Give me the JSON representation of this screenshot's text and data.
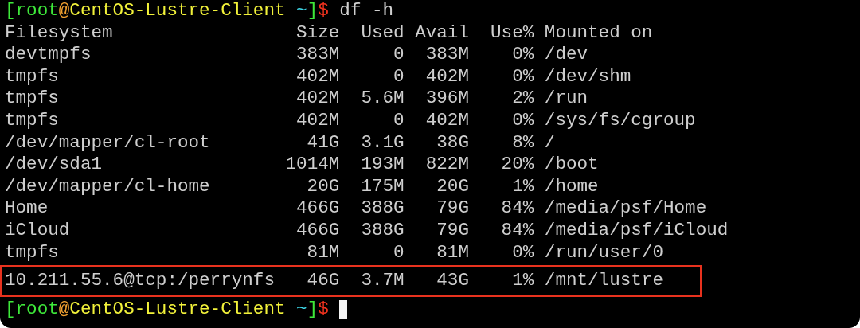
{
  "lines": [
    {
      "kind": "prompt",
      "segments": [
        {
          "text": "[root",
          "color": "#3ee83a"
        },
        {
          "text": "@",
          "color": "#f0a030"
        },
        {
          "text": "CentOS-Lustre-Client",
          "color": "#f2f23a"
        },
        {
          "text": " ~",
          "color": "#3ed8e8"
        },
        {
          "text": "]",
          "color": "#3ee83a"
        },
        {
          "text": "$",
          "color": "#f0321e"
        }
      ],
      "command": "df -h",
      "cursor": false
    },
    {
      "kind": "header",
      "cells": [
        "Filesystem",
        "Size",
        "Used",
        "Avail",
        "Use%",
        "Mounted on"
      ]
    },
    {
      "kind": "row",
      "highlighted": false,
      "cells": [
        "devtmpfs",
        "383M",
        "0",
        "383M",
        "0%",
        "/dev"
      ]
    },
    {
      "kind": "row",
      "highlighted": false,
      "cells": [
        "tmpfs",
        "402M",
        "0",
        "402M",
        "0%",
        "/dev/shm"
      ]
    },
    {
      "kind": "row",
      "highlighted": false,
      "cells": [
        "tmpfs",
        "402M",
        "5.6M",
        "396M",
        "2%",
        "/run"
      ]
    },
    {
      "kind": "row",
      "highlighted": false,
      "cells": [
        "tmpfs",
        "402M",
        "0",
        "402M",
        "0%",
        "/sys/fs/cgroup"
      ]
    },
    {
      "kind": "row",
      "highlighted": false,
      "cells": [
        "/dev/mapper/cl-root",
        "41G",
        "3.1G",
        "38G",
        "8%",
        "/"
      ]
    },
    {
      "kind": "row",
      "highlighted": false,
      "cells": [
        "/dev/sda1",
        "1014M",
        "193M",
        "822M",
        "20%",
        "/boot"
      ]
    },
    {
      "kind": "row",
      "highlighted": false,
      "cells": [
        "/dev/mapper/cl-home",
        "20G",
        "175M",
        "20G",
        "1%",
        "/home"
      ]
    },
    {
      "kind": "row",
      "highlighted": false,
      "cells": [
        "Home",
        "466G",
        "388G",
        "79G",
        "84%",
        "/media/psf/Home"
      ]
    },
    {
      "kind": "row",
      "highlighted": false,
      "cells": [
        "iCloud",
        "466G",
        "388G",
        "79G",
        "84%",
        "/media/psf/iCloud"
      ]
    },
    {
      "kind": "row",
      "highlighted": false,
      "cells": [
        "tmpfs",
        "81M",
        "0",
        "81M",
        "0%",
        "/run/user/0"
      ]
    },
    {
      "kind": "row",
      "highlighted": true,
      "cells": [
        "10.211.55.6@tcp:/perrynfs",
        "46G",
        "3.7M",
        "43G",
        "1%",
        "/mnt/lustre"
      ]
    },
    {
      "kind": "prompt",
      "segments": [
        {
          "text": "[root",
          "color": "#3ee83a"
        },
        {
          "text": "@",
          "color": "#f0a030"
        },
        {
          "text": "CentOS-Lustre-Client",
          "color": "#f2f23a"
        },
        {
          "text": " ~",
          "color": "#3ed8e8"
        },
        {
          "text": "]",
          "color": "#3ee83a"
        },
        {
          "text": "$",
          "color": "#f0321e"
        }
      ],
      "cursor": true
    }
  ]
}
